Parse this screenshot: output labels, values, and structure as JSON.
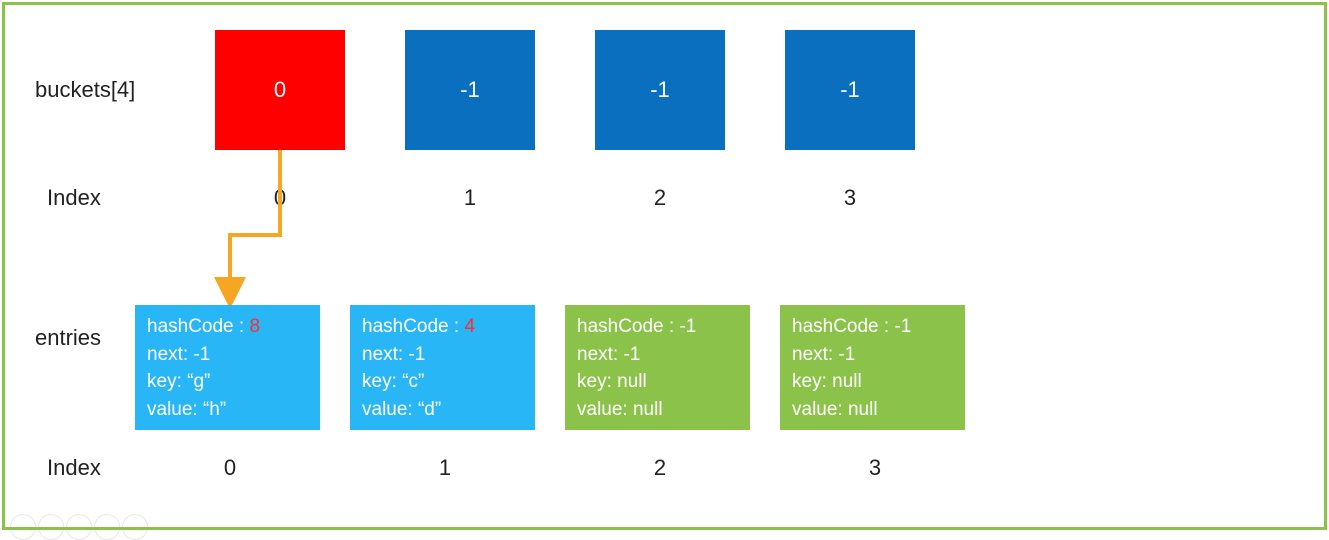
{
  "labels": {
    "buckets": "buckets[4]",
    "index": "Index",
    "entries": "entries"
  },
  "buckets": [
    {
      "value": "0",
      "color": "red"
    },
    {
      "value": "-1",
      "color": "blue"
    },
    {
      "value": "-1",
      "color": "blue"
    },
    {
      "value": "-1",
      "color": "blue"
    }
  ],
  "bucket_indices": [
    "0",
    "1",
    "2",
    "3"
  ],
  "entries": [
    {
      "hashLabel": "hashCode : ",
      "hash": "8",
      "hashRed": true,
      "next": "next: -1",
      "key": "key: “g”",
      "value": "value: “h”",
      "color": "cyan"
    },
    {
      "hashLabel": "hashCode : ",
      "hash": "4",
      "hashRed": true,
      "next": "next: -1",
      "key": "key: “c”",
      "value": "value: “d”",
      "color": "cyan"
    },
    {
      "hashLabel": "hashCode : ",
      "hash": "-1",
      "hashRed": false,
      "next": "next: -1",
      "key": "key: null",
      "value": "value: null",
      "color": "green"
    },
    {
      "hashLabel": "hashCode : ",
      "hash": "-1",
      "hashRed": false,
      "next": "next: -1",
      "key": "key: null",
      "value": "value: null",
      "color": "green"
    }
  ],
  "entry_indices": [
    "0",
    "1",
    "2",
    "3"
  ],
  "arrow": {
    "color": "#f5a623"
  }
}
